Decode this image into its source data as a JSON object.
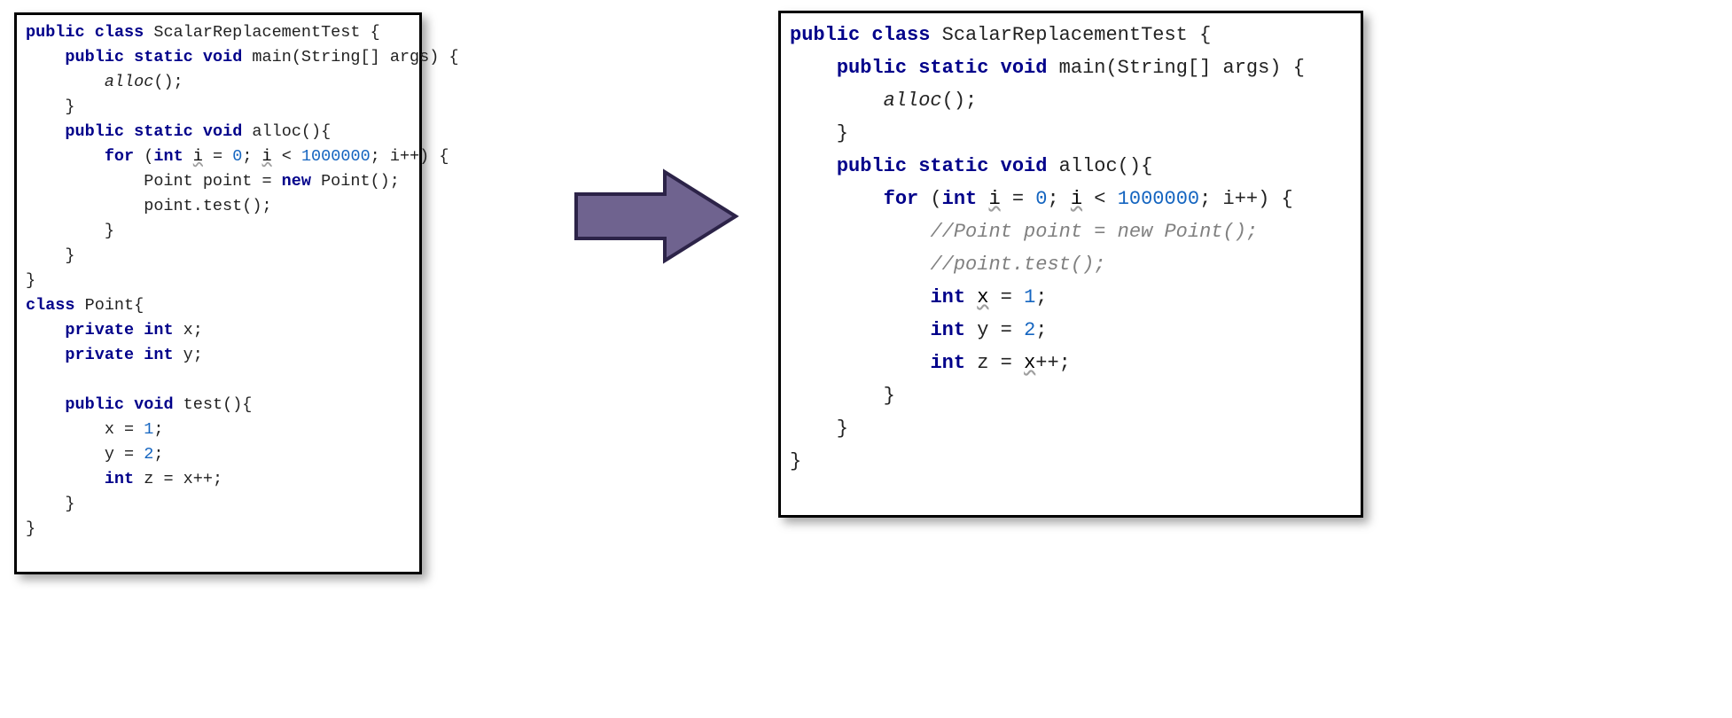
{
  "arrow": {
    "fill": "#6f638f",
    "stroke": "#2c2348"
  },
  "left_code": {
    "tokens": [
      [
        {
          "t": "public",
          "c": "kw"
        },
        {
          "t": " ",
          "c": "pln"
        },
        {
          "t": "class",
          "c": "kw"
        },
        {
          "t": " ScalarReplacementTest {",
          "c": "pln"
        }
      ],
      [
        {
          "t": "    ",
          "c": "pln"
        },
        {
          "t": "public",
          "c": "kw"
        },
        {
          "t": " ",
          "c": "pln"
        },
        {
          "t": "static",
          "c": "kw"
        },
        {
          "t": " ",
          "c": "pln"
        },
        {
          "t": "void",
          "c": "kw"
        },
        {
          "t": " main(String[] args) {",
          "c": "pln"
        }
      ],
      [
        {
          "t": "        ",
          "c": "pln"
        },
        {
          "t": "alloc",
          "c": "itl"
        },
        {
          "t": "();",
          "c": "pln"
        }
      ],
      [
        {
          "t": "    }",
          "c": "pln"
        }
      ],
      [
        {
          "t": "    ",
          "c": "pln"
        },
        {
          "t": "public",
          "c": "kw"
        },
        {
          "t": " ",
          "c": "pln"
        },
        {
          "t": "static",
          "c": "kw"
        },
        {
          "t": " ",
          "c": "pln"
        },
        {
          "t": "void",
          "c": "kw"
        },
        {
          "t": " alloc(){",
          "c": "pln"
        }
      ],
      [
        {
          "t": "        ",
          "c": "pln"
        },
        {
          "t": "for",
          "c": "kw"
        },
        {
          "t": " (",
          "c": "pln"
        },
        {
          "t": "int",
          "c": "kw"
        },
        {
          "t": " ",
          "c": "pln"
        },
        {
          "t": "i",
          "c": "wavy"
        },
        {
          "t": " = ",
          "c": "pln"
        },
        {
          "t": "0",
          "c": "num"
        },
        {
          "t": "; ",
          "c": "pln"
        },
        {
          "t": "i",
          "c": "wavy"
        },
        {
          "t": " < ",
          "c": "pln"
        },
        {
          "t": "1000000",
          "c": "num"
        },
        {
          "t": "; i++) {",
          "c": "pln"
        }
      ],
      [
        {
          "t": "            Point point = ",
          "c": "pln"
        },
        {
          "t": "new",
          "c": "kw"
        },
        {
          "t": " Point();",
          "c": "pln"
        }
      ],
      [
        {
          "t": "            point.test();",
          "c": "pln"
        }
      ],
      [
        {
          "t": "        }",
          "c": "pln"
        }
      ],
      [
        {
          "t": "    }",
          "c": "pln"
        }
      ],
      [
        {
          "t": "}",
          "c": "pln"
        }
      ],
      [
        {
          "t": "class",
          "c": "kw"
        },
        {
          "t": " Point{",
          "c": "pln"
        }
      ],
      [
        {
          "t": "    ",
          "c": "pln"
        },
        {
          "t": "private",
          "c": "kw"
        },
        {
          "t": " ",
          "c": "pln"
        },
        {
          "t": "int",
          "c": "kw"
        },
        {
          "t": " x;",
          "c": "pln"
        }
      ],
      [
        {
          "t": "    ",
          "c": "pln"
        },
        {
          "t": "private",
          "c": "kw"
        },
        {
          "t": " ",
          "c": "pln"
        },
        {
          "t": "int",
          "c": "kw"
        },
        {
          "t": " y;",
          "c": "pln"
        }
      ],
      [
        {
          "t": "",
          "c": "pln"
        }
      ],
      [
        {
          "t": "    ",
          "c": "pln"
        },
        {
          "t": "public",
          "c": "kw"
        },
        {
          "t": " ",
          "c": "pln"
        },
        {
          "t": "void",
          "c": "kw"
        },
        {
          "t": " test(){",
          "c": "pln"
        }
      ],
      [
        {
          "t": "        x = ",
          "c": "pln"
        },
        {
          "t": "1",
          "c": "num"
        },
        {
          "t": ";",
          "c": "pln"
        }
      ],
      [
        {
          "t": "        y = ",
          "c": "pln"
        },
        {
          "t": "2",
          "c": "num"
        },
        {
          "t": ";",
          "c": "pln"
        }
      ],
      [
        {
          "t": "        ",
          "c": "pln"
        },
        {
          "t": "int",
          "c": "kw"
        },
        {
          "t": " z = x++;",
          "c": "pln"
        }
      ],
      [
        {
          "t": "    }",
          "c": "pln"
        }
      ],
      [
        {
          "t": "}",
          "c": "pln"
        }
      ]
    ]
  },
  "right_code": {
    "tokens": [
      [
        {
          "t": "public",
          "c": "kw"
        },
        {
          "t": " ",
          "c": "pln"
        },
        {
          "t": "class",
          "c": "kw"
        },
        {
          "t": " ScalarReplacementTest {",
          "c": "pln"
        }
      ],
      [
        {
          "t": "    ",
          "c": "pln"
        },
        {
          "t": "public",
          "c": "kw"
        },
        {
          "t": " ",
          "c": "pln"
        },
        {
          "t": "static",
          "c": "kw"
        },
        {
          "t": " ",
          "c": "pln"
        },
        {
          "t": "void",
          "c": "kw"
        },
        {
          "t": " main(String[] args) {",
          "c": "pln"
        }
      ],
      [
        {
          "t": "        ",
          "c": "pln"
        },
        {
          "t": "alloc",
          "c": "itl"
        },
        {
          "t": "();",
          "c": "pln"
        }
      ],
      [
        {
          "t": "    }",
          "c": "pln"
        }
      ],
      [
        {
          "t": "    ",
          "c": "pln"
        },
        {
          "t": "public",
          "c": "kw"
        },
        {
          "t": " ",
          "c": "pln"
        },
        {
          "t": "static",
          "c": "kw"
        },
        {
          "t": " ",
          "c": "pln"
        },
        {
          "t": "void",
          "c": "kw"
        },
        {
          "t": " alloc(){",
          "c": "pln"
        }
      ],
      [
        {
          "t": "        ",
          "c": "pln"
        },
        {
          "t": "for",
          "c": "kw"
        },
        {
          "t": " (",
          "c": "pln"
        },
        {
          "t": "int",
          "c": "kw"
        },
        {
          "t": " ",
          "c": "pln"
        },
        {
          "t": "i",
          "c": "wavy"
        },
        {
          "t": " = ",
          "c": "pln"
        },
        {
          "t": "0",
          "c": "num"
        },
        {
          "t": "; ",
          "c": "pln"
        },
        {
          "t": "i",
          "c": "wavy"
        },
        {
          "t": " < ",
          "c": "pln"
        },
        {
          "t": "1000000",
          "c": "num"
        },
        {
          "t": "; i++) {",
          "c": "pln"
        }
      ],
      [
        {
          "t": "            ",
          "c": "pln"
        },
        {
          "t": "//Point point = new Point();",
          "c": "cmt"
        }
      ],
      [
        {
          "t": "            ",
          "c": "pln"
        },
        {
          "t": "//point.test();",
          "c": "cmt"
        }
      ],
      [
        {
          "t": "            ",
          "c": "pln"
        },
        {
          "t": "int",
          "c": "kw"
        },
        {
          "t": " ",
          "c": "pln"
        },
        {
          "t": "x",
          "c": "wavy"
        },
        {
          "t": " = ",
          "c": "pln"
        },
        {
          "t": "1",
          "c": "num"
        },
        {
          "t": ";",
          "c": "pln"
        }
      ],
      [
        {
          "t": "            ",
          "c": "pln"
        },
        {
          "t": "int",
          "c": "kw"
        },
        {
          "t": " y = ",
          "c": "pln"
        },
        {
          "t": "2",
          "c": "num"
        },
        {
          "t": ";",
          "c": "pln"
        }
      ],
      [
        {
          "t": "            ",
          "c": "pln"
        },
        {
          "t": "int",
          "c": "kw"
        },
        {
          "t": " z = ",
          "c": "pln"
        },
        {
          "t": "x",
          "c": "wavy"
        },
        {
          "t": "++;",
          "c": "pln"
        }
      ],
      [
        {
          "t": "        }",
          "c": "pln"
        }
      ],
      [
        {
          "t": "    }",
          "c": "pln"
        }
      ],
      [
        {
          "t": "}",
          "c": "pln"
        }
      ]
    ]
  }
}
